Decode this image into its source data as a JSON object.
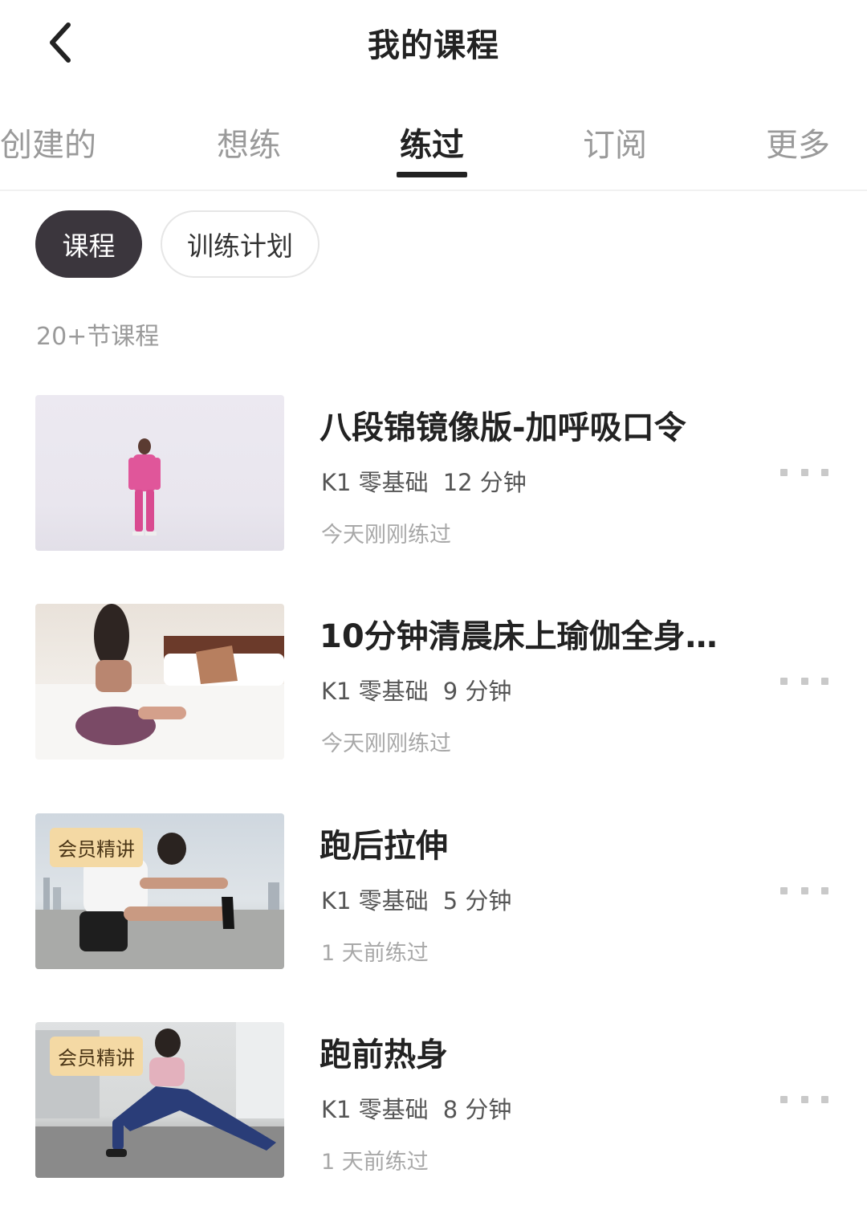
{
  "header": {
    "title": "我的课程",
    "back_icon": "chevron-left-icon"
  },
  "tabs": [
    {
      "label": "创建的",
      "active": false
    },
    {
      "label": "想练",
      "active": false
    },
    {
      "label": "练过",
      "active": true
    },
    {
      "label": "订阅",
      "active": false
    },
    {
      "label": "更多",
      "active": false
    }
  ],
  "filters": [
    {
      "label": "课程",
      "active": true
    },
    {
      "label": "训练计划",
      "active": false
    }
  ],
  "count_label": "20+节课程",
  "colors": {
    "chip_active": "#3b363d",
    "badge": "#f4d9a4",
    "text_primary": "#222222",
    "text_secondary": "#9a9a9a"
  },
  "courses": [
    {
      "title": "八段锦镜像版-加呼吸口令",
      "level": "K1 零基础",
      "duration": "12 分钟",
      "practiced": "今天刚刚练过",
      "badge": ""
    },
    {
      "title": "10分钟清晨床上瑜伽全身…",
      "level": "K1 零基础",
      "duration": "9 分钟",
      "practiced": "今天刚刚练过",
      "badge": ""
    },
    {
      "title": "跑后拉伸",
      "level": "K1 零基础",
      "duration": "5 分钟",
      "practiced": "1 天前练过",
      "badge": "会员精讲"
    },
    {
      "title": "跑前热身",
      "level": "K1 零基础",
      "duration": "8 分钟",
      "practiced": "1 天前练过",
      "badge": "会员精讲"
    }
  ]
}
